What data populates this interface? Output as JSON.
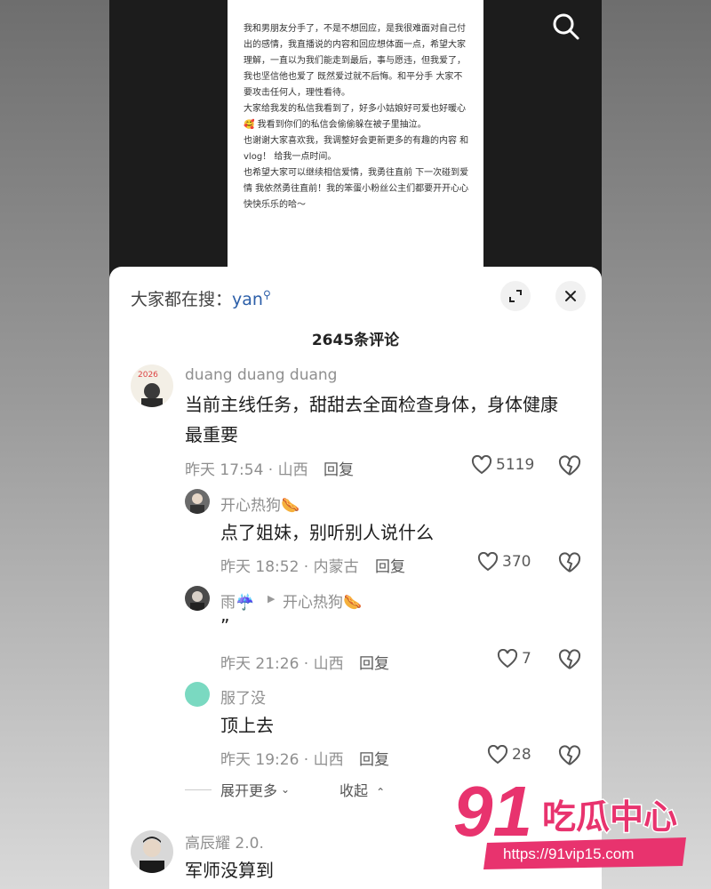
{
  "note": {
    "paragraphs": [
      "我和男朋友分手了，不是不想回应，是我很难面对自己付出的感情，我直播说的内容和回应想体面一点，希望大家理解，一直以为我们能走到最后，事与愿违，但我爱了，我也坚信他也爱了 既然爱过就不后悔。和平分手 大家不要攻击任何人，理性看待。",
      "大家给我发的私信我看到了，好多小姑娘好可爱也好暖心 🥰 我看到你们的私信会偷偷躲在被子里抽泣。",
      "也谢谢大家喜欢我，我调整好会更新更多的有趣的内容 和vlog！ 给我一点时间。",
      "也希望大家可以继续相信爱情，我勇往直前 下一次碰到爱情 我依然勇往直前！我的笨蛋小粉丝公主们都要开开心心快快乐乐的哈～"
    ]
  },
  "sheet": {
    "search_prefix": "大家都在搜：",
    "search_keyword": "yan",
    "comment_count": "2645条评论"
  },
  "comments": [
    {
      "author": "duang duang duang",
      "text1": "当前主线任务，甜甜去全面检查身体，身体健康",
      "text2": "最重要",
      "meta": "昨天 17:54 · 山西",
      "reply": "回复",
      "likes": "5119"
    },
    {
      "author": "开心热狗🌭",
      "text": "点了姐妹，别听别人说什么",
      "meta": "昨天 18:52 · 内蒙古",
      "reply": "回复",
      "likes": "370"
    },
    {
      "author": "雨☔️",
      "reply_to": "开心热狗🌭",
      "text": "”",
      "meta": "昨天 21:26 · 山西",
      "reply": "回复",
      "likes": "7"
    },
    {
      "author": "服了没",
      "text": "顶上去",
      "meta": "昨天 19:26 · 山西",
      "reply": "回复",
      "likes": "28"
    },
    {
      "author": "高辰耀 2.0.",
      "text": "军师没算到"
    }
  ],
  "controls": {
    "expand_more": "展开更多",
    "collapse": "收起"
  },
  "watermark": {
    "brand": "91吃瓜中心",
    "url": "https://91vip15.com"
  },
  "colors": {
    "accent_blue": "#2b5ea8",
    "watermark_pink": "#e8336e",
    "mint_avatar": "#7ad9c1"
  }
}
